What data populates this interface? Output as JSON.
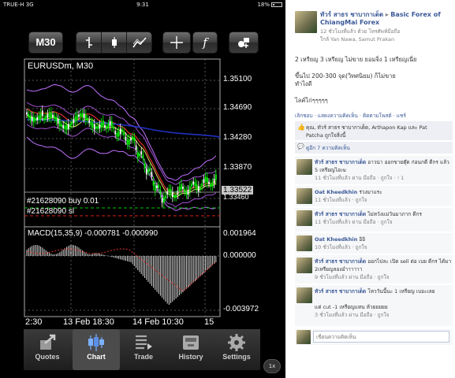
{
  "status_bar": {
    "carrier": "TRUE-H",
    "network": "3G",
    "time": "9:31",
    "battery": "18%"
  },
  "toolbar": {
    "timeframe": "M30",
    "f_label": "f"
  },
  "chart_data": {
    "type": "candlestick",
    "title": "EURUSDm, M30",
    "price_axis": {
      "labels": [
        "1.35100",
        "1.34690",
        "1.34280",
        "1.33870",
        "1.33460"
      ],
      "ylim": [
        1.3334,
        1.3524
      ]
    },
    "current_price": "1.33522",
    "time_axis": {
      "labels": [
        "2:30",
        "13 Feb 18:30",
        "14 Feb 10:30",
        "15"
      ]
    },
    "orders": [
      "#21628090 buy 0.01",
      "#21628090 sl"
    ],
    "indicator": {
      "label": "MACD(15,35,9) -0.000781 -0.000990",
      "axis_labels": [
        "0.001964",
        "0.000000",
        "-0.003972"
      ]
    },
    "colors": {
      "bull": "#00ff00",
      "bear": "#ffffff",
      "ma_blue": "#2030c0",
      "ma_red": "#e0302a",
      "bands": "#c070ff",
      "ma_yellow": "#e0e060"
    }
  },
  "tabs": [
    {
      "label": "Quotes",
      "icon": "quotes-icon"
    },
    {
      "label": "Chart",
      "icon": "chart-icon"
    },
    {
      "label": "Trade",
      "icon": "trade-icon"
    },
    {
      "label": "History",
      "icon": "history-icon"
    },
    {
      "label": "Settings",
      "icon": "settings-icon"
    }
  ],
  "zoom": "1x",
  "post": {
    "author": "ทัวร์ สาธร ชาบากาเด็ด",
    "arrow": "▸",
    "group": "Basic Forex of ChiangMai Forex",
    "meta": "12 ชั่วโมงที่แล้ว ด้วย โทรศัพท์มือถือ",
    "location": "ใกล้ Yan Nawa, Samut Prakan",
    "body1": "2 เหรียญ 3 เหรียญ ไม่ขาย ยอมจิ่ง 1 เหรียญเนี่ย",
    "body2": "ขึ้นไป 200-300 จุด(วิทศนิยม) ก็ไม่ขาย",
    "body3": "ทำไงดี",
    "body4": "ไลค์ไก่ๆๆๆๆๆ",
    "actions": "เลิกชอบ · แสดงความคิดเห็น · ติดตามโพสต์ · แชร์",
    "likes_line1": "คุณ, ทัวร์ สาธร ชาบากาเด็ด, Arthapon Kap และ Pat",
    "likes_line2": "Patcha ถูกใจสิ่งนี้",
    "view_comments": "ดูอีก 7 ความคิดเห็น"
  },
  "comments": [
    {
      "name": "ทัวร์ สาธร ชาบากาเด็ด",
      "text": "อาวน่า ออกขายตุ๊ด ก่อนกดี ดีกร แล้ว 5 เหรียญไอเฆ",
      "meta": "11 ชั่วโมงที่แล้ว ผ่าน มือถือ · ถูกใจ · ⁲ 1"
    },
    {
      "name": "Oat Kheedkhin",
      "text": "ร่วงมาแระ",
      "meta": "11 ชั่วโมงที่แล้ว · ถูกใจ"
    },
    {
      "name": "ทัวร์ สาธร ชาบากาเด็ด",
      "text": "ไม่หวังแม่วันมาภาก ดีกร",
      "meta": "11 ชั่วโมงที่แล้ว ผ่าน มือถือ · ถูกใจ"
    },
    {
      "name": "Oat Kheedkhin",
      "text": "อิอิ",
      "meta": "10 ชั่วโมงที่แล้ว · ถูกใจ"
    },
    {
      "name": "ทัวร์ สาธร ชาบากาเด็ด",
      "text": "ออกไปละ เปิด sell ต่อ เบย ดีกร ได้มา 2เหรียญลองอำาาาาา",
      "meta": "9 ชั่วโมงที่แล้ว ผ่าน มือถือ · ถูกใจ"
    },
    {
      "name": "ทัวร์ สาธร ชาบากาเด็ด",
      "text": "โหววันนี้นะ 1 เหรียญ เบอะเลย",
      "extra": "แต่ cut -1 เหรียญแทน ห้วยยยยย",
      "meta": "3 ชั่วโมงที่แล้ว ผ่าน มือถือ · ถูกใจ"
    }
  ],
  "comment_box_placeholder": "เขียนความคิดเห็น"
}
